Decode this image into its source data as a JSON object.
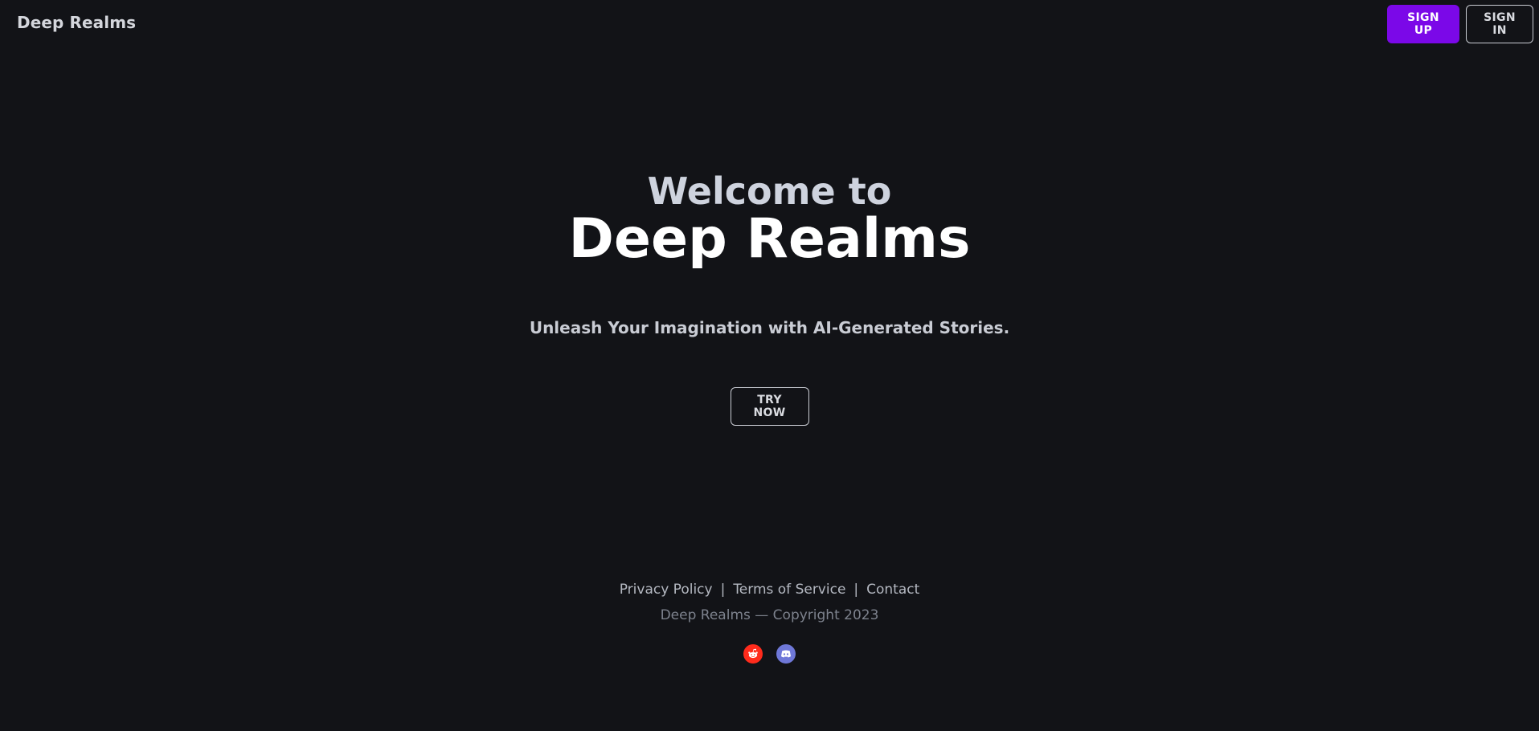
{
  "navbar": {
    "brand": "Deep Realms",
    "sign_up_label": "SIGN UP",
    "sign_in_label": "SIGN IN"
  },
  "hero": {
    "subheading": "Welcome to",
    "heading": "Deep Realms",
    "tagline": "Unleash Your Imagination with AI-Generated Stories.",
    "cta_label": "TRY NOW"
  },
  "footer": {
    "links": [
      "Privacy Policy",
      "Terms of Service",
      "Contact"
    ],
    "separator": "|",
    "copyright": "Deep Realms — Copyright 2023",
    "social": [
      {
        "icon": "reddit-icon",
        "color": "#ff2b1c"
      },
      {
        "icon": "discord-icon",
        "color": "#6f78d8"
      }
    ]
  },
  "colors": {
    "background": "#121317",
    "primary": "#7b08e8"
  }
}
